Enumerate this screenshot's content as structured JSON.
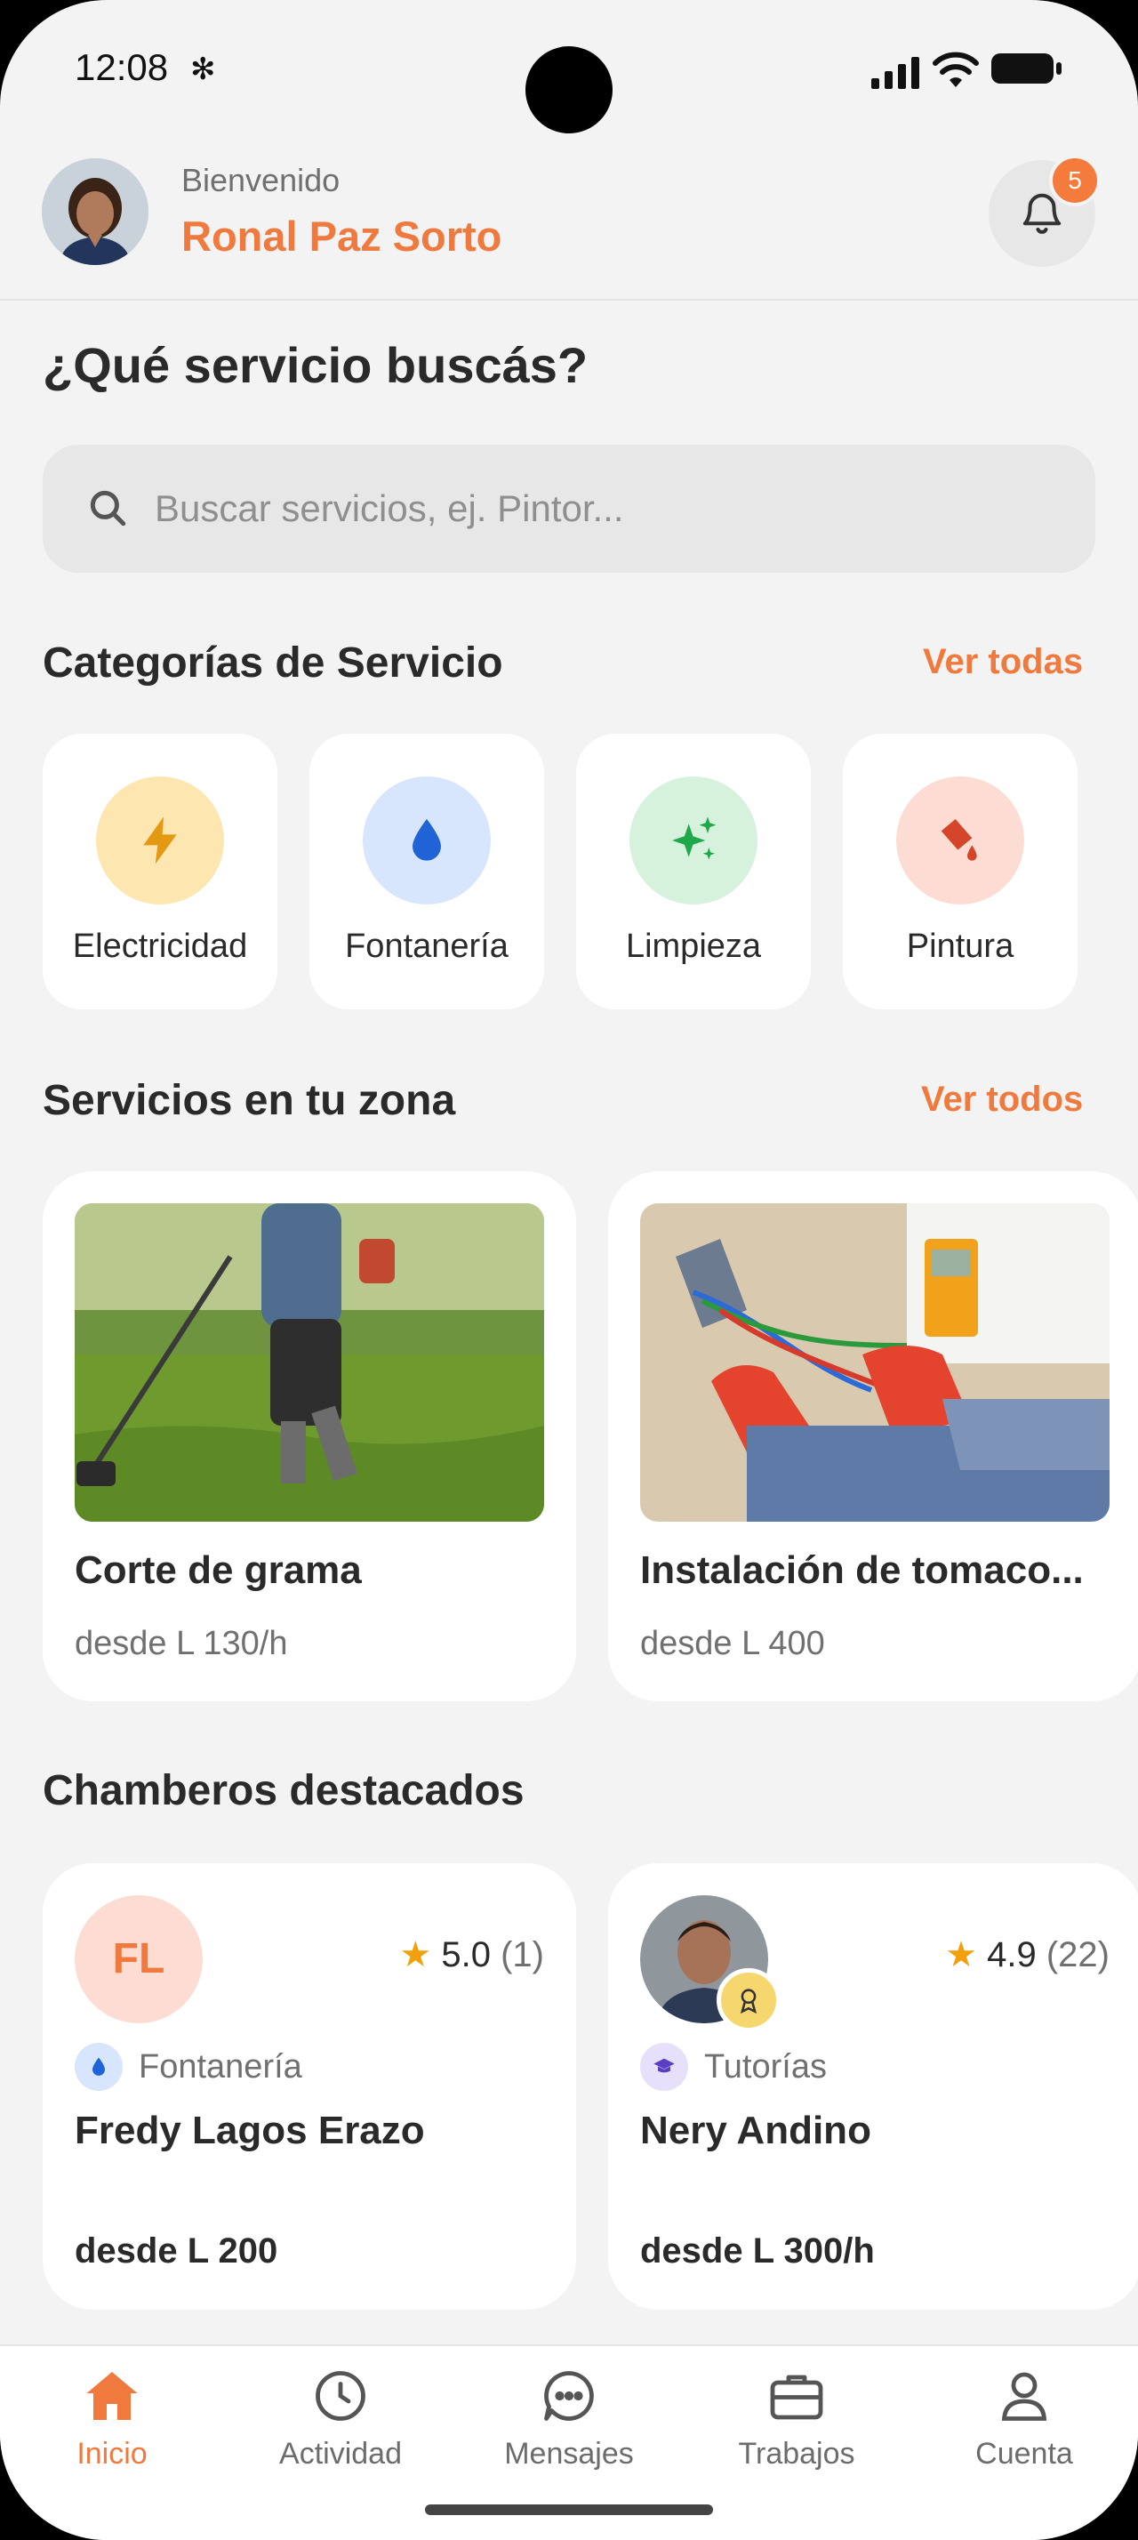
{
  "status_bar": {
    "time": "12:08"
  },
  "header": {
    "welcome_label": "Bienvenido",
    "user_name": "Ronal Paz Sorto",
    "notification_count": "5"
  },
  "search": {
    "title": "¿Qué servicio buscás?",
    "placeholder": "Buscar servicios, ej. Pintor..."
  },
  "categories": {
    "title": "Categorías de Servicio",
    "see_all": "Ver todas",
    "items": [
      {
        "label": "Electricidad",
        "icon": "lightning-icon",
        "bg": "#fde6b0",
        "color": "#e39a12"
      },
      {
        "label": "Fontanería",
        "icon": "water-drop-icon",
        "bg": "#d8e6fd",
        "color": "#1f63d6"
      },
      {
        "label": "Limpieza",
        "icon": "sparkles-icon",
        "bg": "#d6f2dd",
        "color": "#1fa84a"
      },
      {
        "label": "Pintura",
        "icon": "paint-bucket-icon",
        "bg": "#fddcd3",
        "color": "#d4452a"
      }
    ]
  },
  "services": {
    "title": "Servicios en tu zona",
    "see_all": "Ver todos",
    "items": [
      {
        "title": "Corte de grama",
        "price": "desde L 130/h"
      },
      {
        "title": "Instalación de tomaco...",
        "price": "desde L 400"
      }
    ]
  },
  "workers": {
    "title": "Chamberos destacados",
    "items": [
      {
        "initials": "FL",
        "rating": "5.0",
        "reviews": "(1)",
        "category": "Fontanería",
        "name": "Fredy Lagos Erazo",
        "price": "desde L 200"
      },
      {
        "initials": "",
        "rating": "4.9",
        "reviews": "(22)",
        "category": "Tutorías",
        "name": "Nery Andino",
        "price": "desde L 300/h"
      }
    ]
  },
  "nav": {
    "items": [
      {
        "label": "Inicio",
        "icon": "home-icon",
        "active": true
      },
      {
        "label": "Actividad",
        "icon": "clock-icon",
        "active": false
      },
      {
        "label": "Mensajes",
        "icon": "chat-icon",
        "active": false
      },
      {
        "label": "Trabajos",
        "icon": "briefcase-icon",
        "active": false
      },
      {
        "label": "Cuenta",
        "icon": "user-icon",
        "active": false
      }
    ]
  },
  "colors": {
    "accent": "#f07a3e",
    "background": "#f3f3f3",
    "card": "#ffffff"
  }
}
